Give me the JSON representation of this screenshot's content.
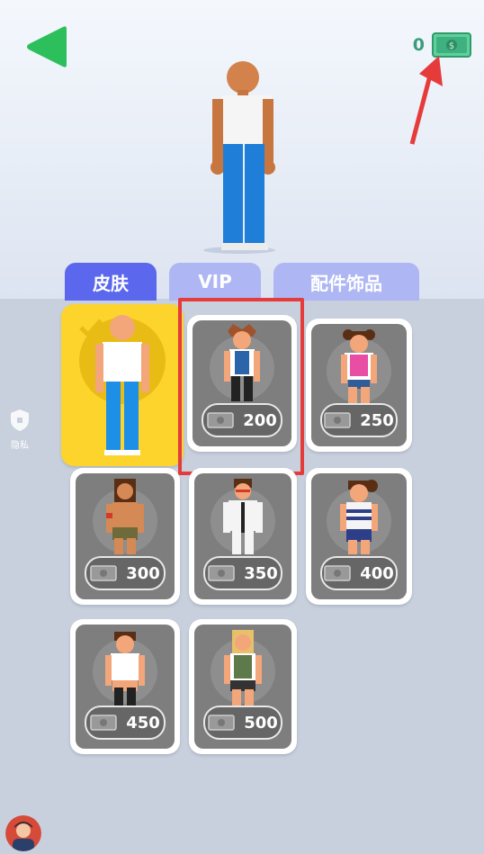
{
  "header": {
    "money": "0"
  },
  "tabs": [
    {
      "label": "皮肤"
    },
    {
      "label": "VIP"
    },
    {
      "label": "配件饰品"
    }
  ],
  "skins": [
    {
      "name": "default",
      "price": ""
    },
    {
      "price": "200"
    },
    {
      "price": "250"
    },
    {
      "price": "300"
    },
    {
      "price": "350"
    },
    {
      "price": "400"
    },
    {
      "price": "450"
    },
    {
      "price": "500"
    }
  ],
  "privacy": {
    "label": "隐私"
  },
  "colors": {
    "accent": "#5b67ec",
    "tab_inactive": "#aeb6f4",
    "selected": "#fdd42b",
    "highlight": "#e53b3b",
    "back": "#2dbf5b",
    "money": "#3a9c7a"
  }
}
